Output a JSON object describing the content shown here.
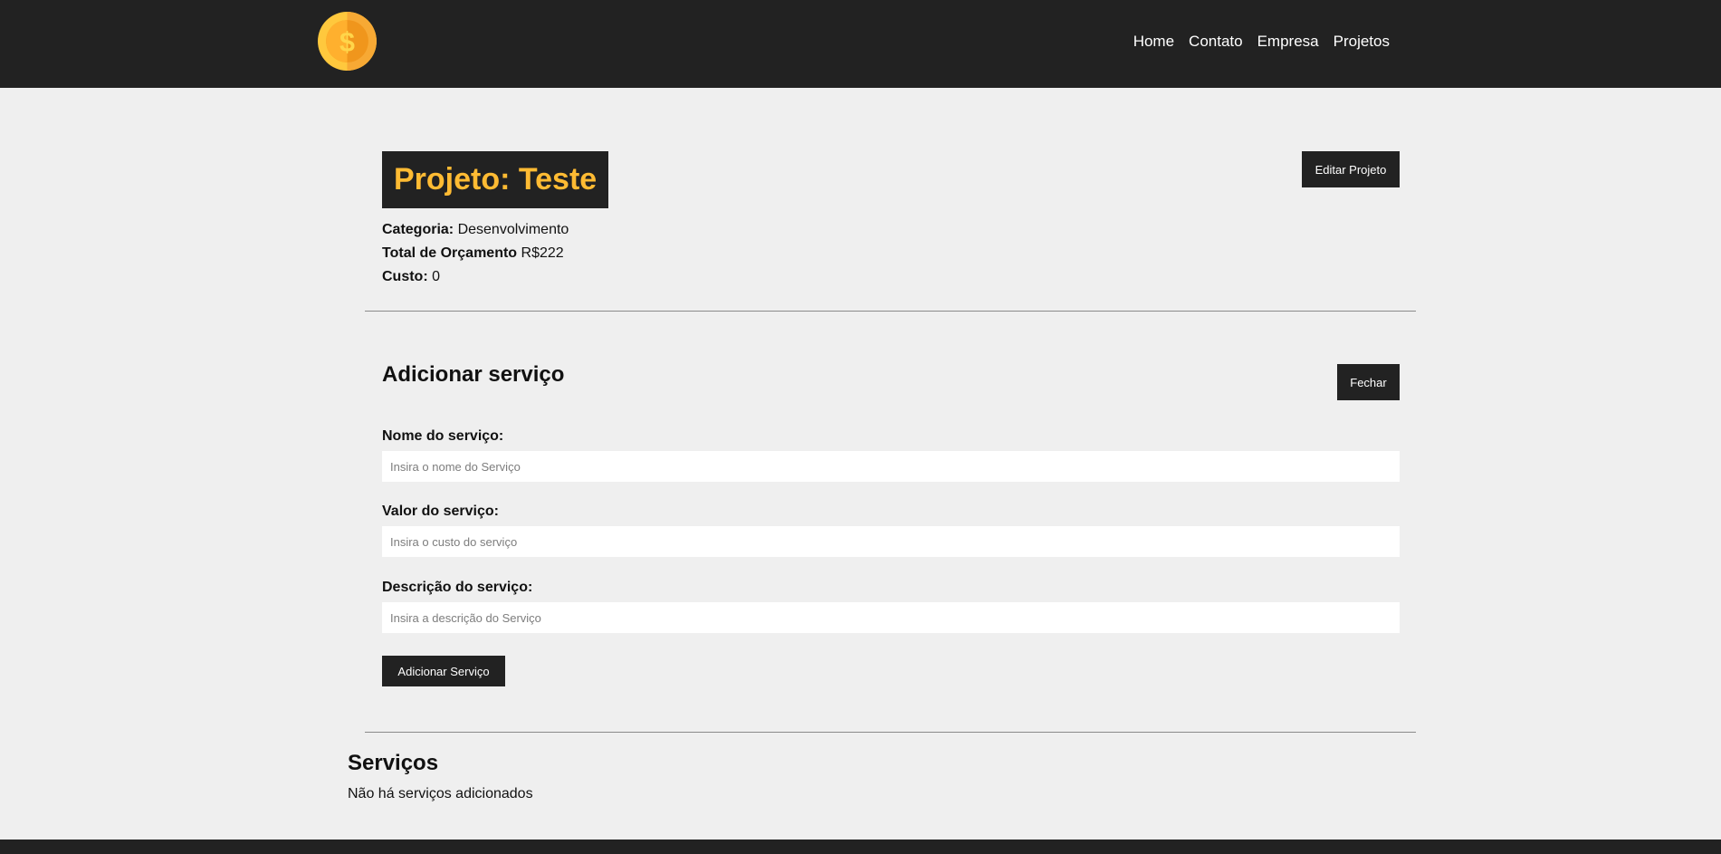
{
  "navbar": {
    "logo_icon": "dollar-coin-icon",
    "links": [
      {
        "label": "Home"
      },
      {
        "label": "Contato"
      },
      {
        "label": "Empresa"
      },
      {
        "label": "Projetos"
      }
    ]
  },
  "project": {
    "title": "Projeto: Teste",
    "edit_button": "Editar Projeto",
    "category_label": "Categoria:",
    "category_value": "Desenvolvimento",
    "budget_label": "Total de Orçamento",
    "budget_value": "R$222",
    "cost_label": "Custo:",
    "cost_value": "0"
  },
  "service_form": {
    "title": "Adicionar serviço",
    "close_button": "Fechar",
    "name_label": "Nome do serviço:",
    "name_placeholder": "Insira o nome do Serviço",
    "value_label": "Valor do serviço:",
    "value_placeholder": "Insira o custo do serviço",
    "description_label": "Descrição do serviço:",
    "description_placeholder": "Insira a descrição do Serviço",
    "submit_button": "Adicionar Serviço"
  },
  "services": {
    "title": "Serviços",
    "empty_message": "Não há serviços adicionados"
  },
  "colors": {
    "dark": "#222222",
    "background": "#efefef",
    "accent": "#ffbb33"
  }
}
